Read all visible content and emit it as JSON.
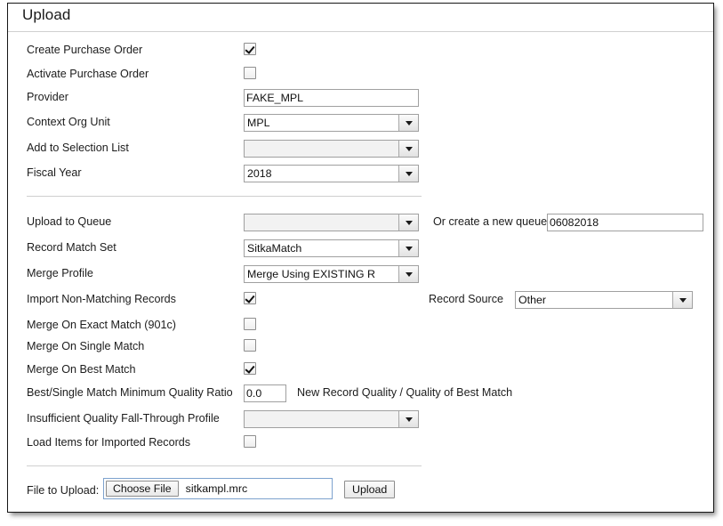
{
  "window": {
    "title": "Upload"
  },
  "section_one": {
    "rows": [
      {
        "label": "Create Purchase Order",
        "type": "checkbox",
        "checked": true
      },
      {
        "label": "Activate Purchase Order",
        "type": "checkbox",
        "checked": false
      },
      {
        "label": "Provider",
        "type": "text",
        "value": "FAKE_MPL"
      },
      {
        "label": "Context Org Unit",
        "type": "select",
        "value": "MPL"
      },
      {
        "label": "Add to Selection List",
        "type": "select",
        "value": ""
      },
      {
        "label": "Fiscal Year",
        "type": "select",
        "value": "2018"
      }
    ]
  },
  "section_two": {
    "rows": [
      {
        "label": "Upload to Queue",
        "type": "select",
        "value": ""
      },
      {
        "label": "Record Match Set",
        "type": "select",
        "value": "SitkaMatch"
      },
      {
        "label": "Merge Profile",
        "type": "select",
        "value": "Merge Using EXISTING R"
      },
      {
        "label": "Import Non-Matching Records",
        "type": "checkbox",
        "checked": true
      },
      {
        "label": "Merge On Exact Match (901c)",
        "type": "checkbox",
        "checked": false
      },
      {
        "label": "Merge On Single Match",
        "type": "checkbox",
        "checked": false
      },
      {
        "label": "Merge On Best Match",
        "type": "checkbox",
        "checked": true
      },
      {
        "label": "Best/Single Match Minimum Quality Ratio",
        "type": "number",
        "value": "0.0"
      },
      {
        "label": "Insufficient Quality Fall-Through Profile",
        "type": "select",
        "value": ""
      },
      {
        "label": "Load Items for Imported Records",
        "type": "checkbox",
        "checked": false
      }
    ],
    "new_queue_label": "Or create a new queue",
    "new_queue_value": "06082018",
    "record_source_label": "Record Source",
    "record_source_value": "Other",
    "quality_hint": "New Record Quality / Quality of Best Match"
  },
  "upload": {
    "file_label": "File to Upload:",
    "choose_file_label": "Choose File",
    "file_name": "sitkampl.mrc",
    "upload_button_label": "Upload"
  }
}
